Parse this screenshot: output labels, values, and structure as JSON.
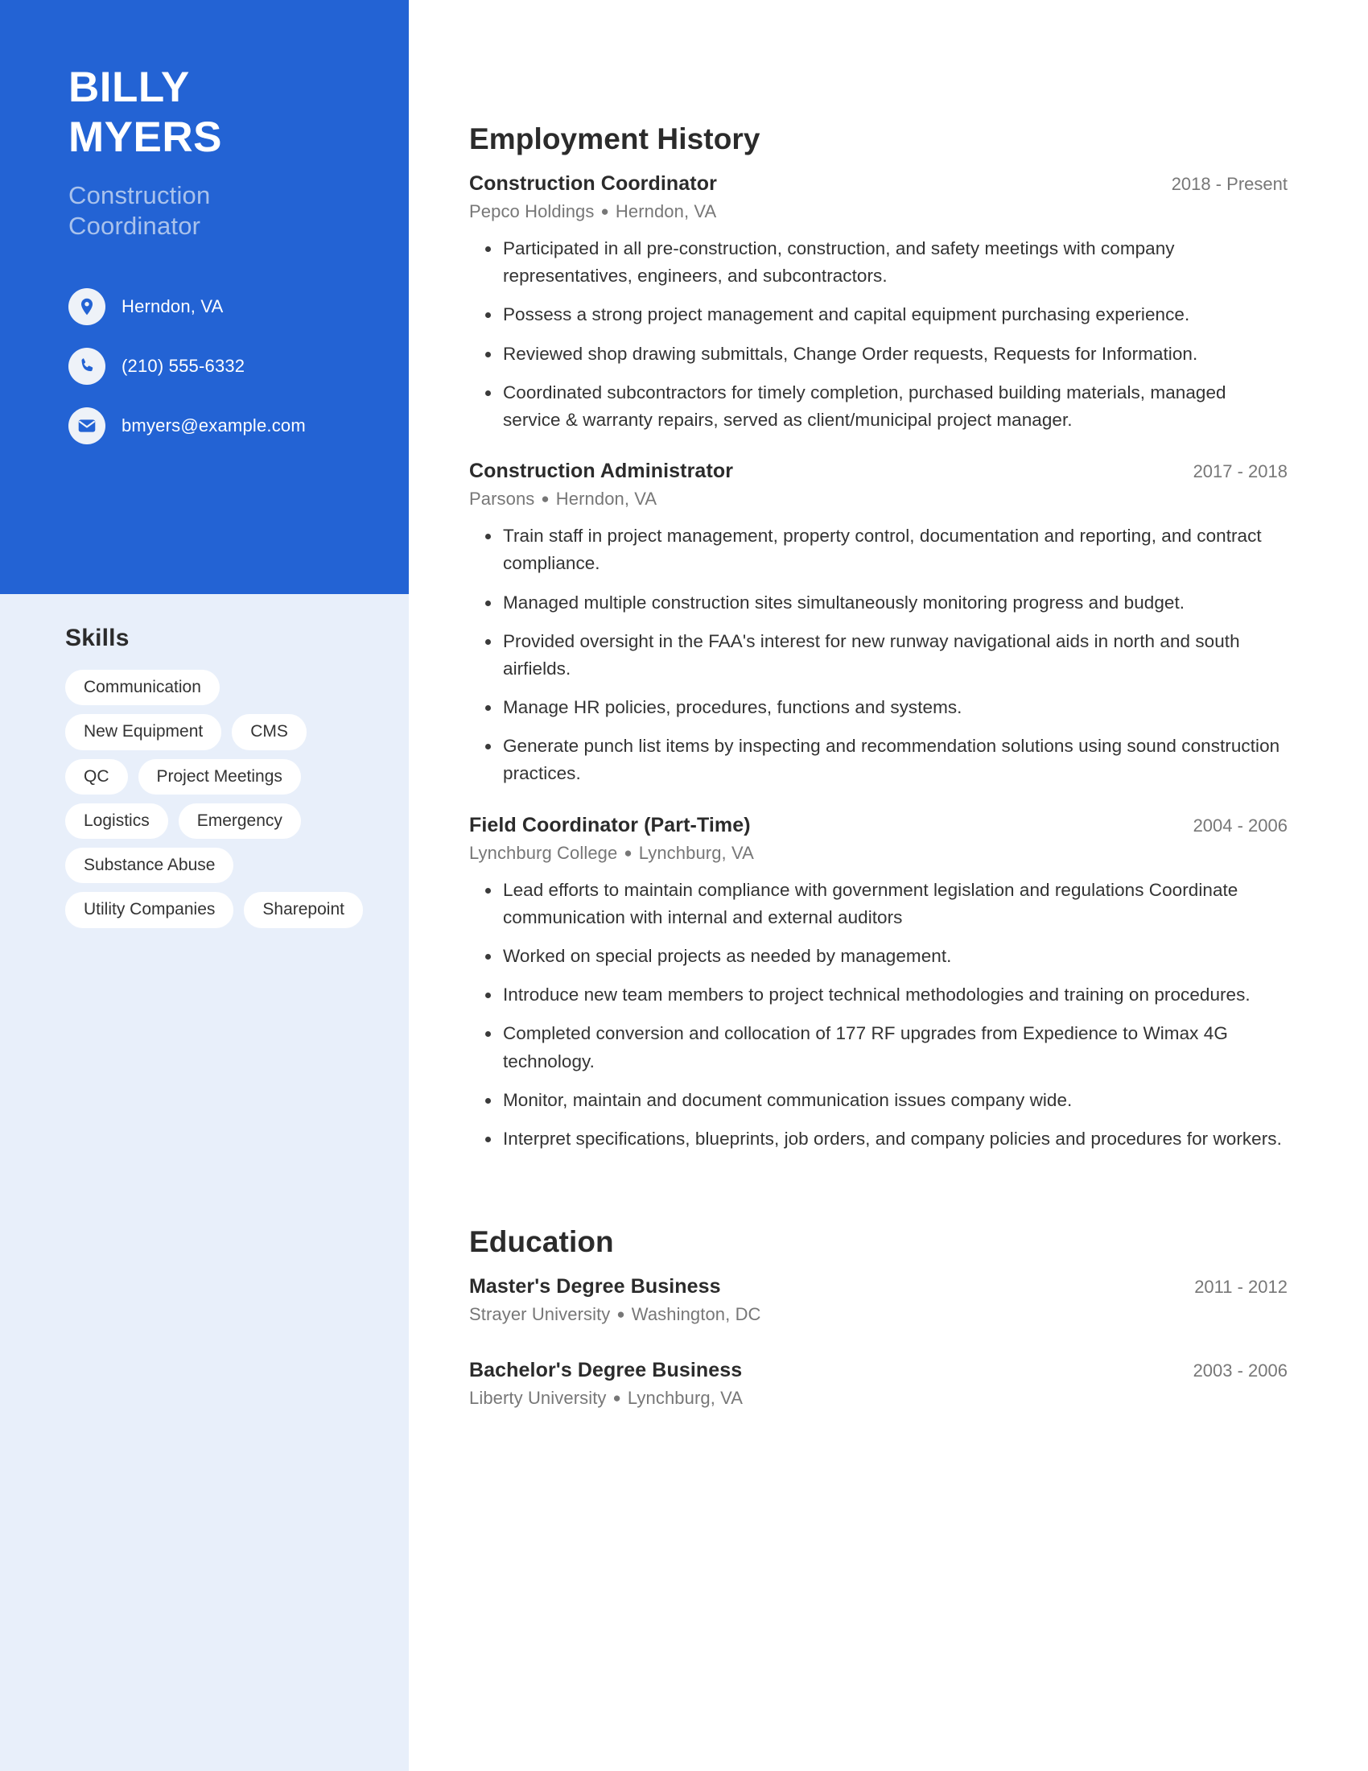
{
  "colors": {
    "header_blue": "#2363d4",
    "sidebar_light": "#e8effa",
    "subtitle_blue": "#a9c2ec",
    "pill_white": "#ffffff",
    "text_dark": "#2b2b2b",
    "text_muted": "#777777"
  },
  "profile": {
    "first_name": "BILLY",
    "last_name": "MYERS",
    "job_title_line1": "Construction",
    "job_title_line2": "Coordinator"
  },
  "contact": {
    "items": [
      {
        "icon": "location-pin-icon",
        "value": "Herndon, VA"
      },
      {
        "icon": "phone-icon",
        "value": "(210) 555-6332"
      },
      {
        "icon": "email-envelope-icon",
        "value": "bmyers@example.com"
      }
    ]
  },
  "skills": {
    "heading": "Skills",
    "items": [
      "Communication",
      "New Equipment",
      "CMS",
      "QC",
      "Project Meetings",
      "Logistics",
      "Emergency",
      "Substance Abuse",
      "Utility Companies",
      "Sharepoint"
    ]
  },
  "employment": {
    "heading": "Employment History",
    "entries": [
      {
        "title": "Construction Coordinator",
        "date": "2018 - Present",
        "company": "Pepco Holdings",
        "location": "Herndon, VA",
        "bullets": [
          "Participated in all pre-construction, construction, and safety meetings with company representatives, engineers, and subcontractors.",
          "Possess a strong project management and capital equipment purchasing experience.",
          "Reviewed shop drawing submittals, Change Order requests, Requests for Information.",
          "Coordinated subcontractors for timely completion, purchased building materials, managed service & warranty repairs, served as client/municipal project manager."
        ]
      },
      {
        "title": "Construction Administrator",
        "date": "2017 - 2018",
        "company": "Parsons",
        "location": "Herndon, VA",
        "bullets": [
          "Train staff in project management, property control, documentation and reporting, and contract compliance.",
          "Managed multiple construction sites simultaneously monitoring progress and budget.",
          "Provided oversight in the FAA's interest for new runway navigational aids in north and south airfields.",
          "Manage HR policies, procedures, functions and systems.",
          "Generate punch list items by inspecting and recommendation solutions using sound construction practices."
        ]
      },
      {
        "title": "Field Coordinator (Part-Time)",
        "date": "2004 - 2006",
        "company": "Lynchburg College",
        "location": "Lynchburg, VA",
        "bullets": [
          "Lead efforts to maintain compliance with government legislation and regulations Coordinate communication with internal and external auditors",
          "Worked on special projects as needed by management.",
          "Introduce new team members to project technical methodologies and training on procedures.",
          "Completed conversion and collocation of 177 RF upgrades from Expedience to Wimax 4G technology.",
          "Monitor, maintain and document communication issues company wide.",
          "Interpret specifications, blueprints, job orders, and company policies and procedures for workers."
        ]
      }
    ]
  },
  "education": {
    "heading": "Education",
    "entries": [
      {
        "title": "Master's Degree Business",
        "date": "2011 - 2012",
        "school": "Strayer University",
        "location": "Washington, DC"
      },
      {
        "title": "Bachelor's Degree Business",
        "date": "2003 - 2006",
        "school": "Liberty University",
        "location": "Lynchburg, VA"
      }
    ]
  }
}
